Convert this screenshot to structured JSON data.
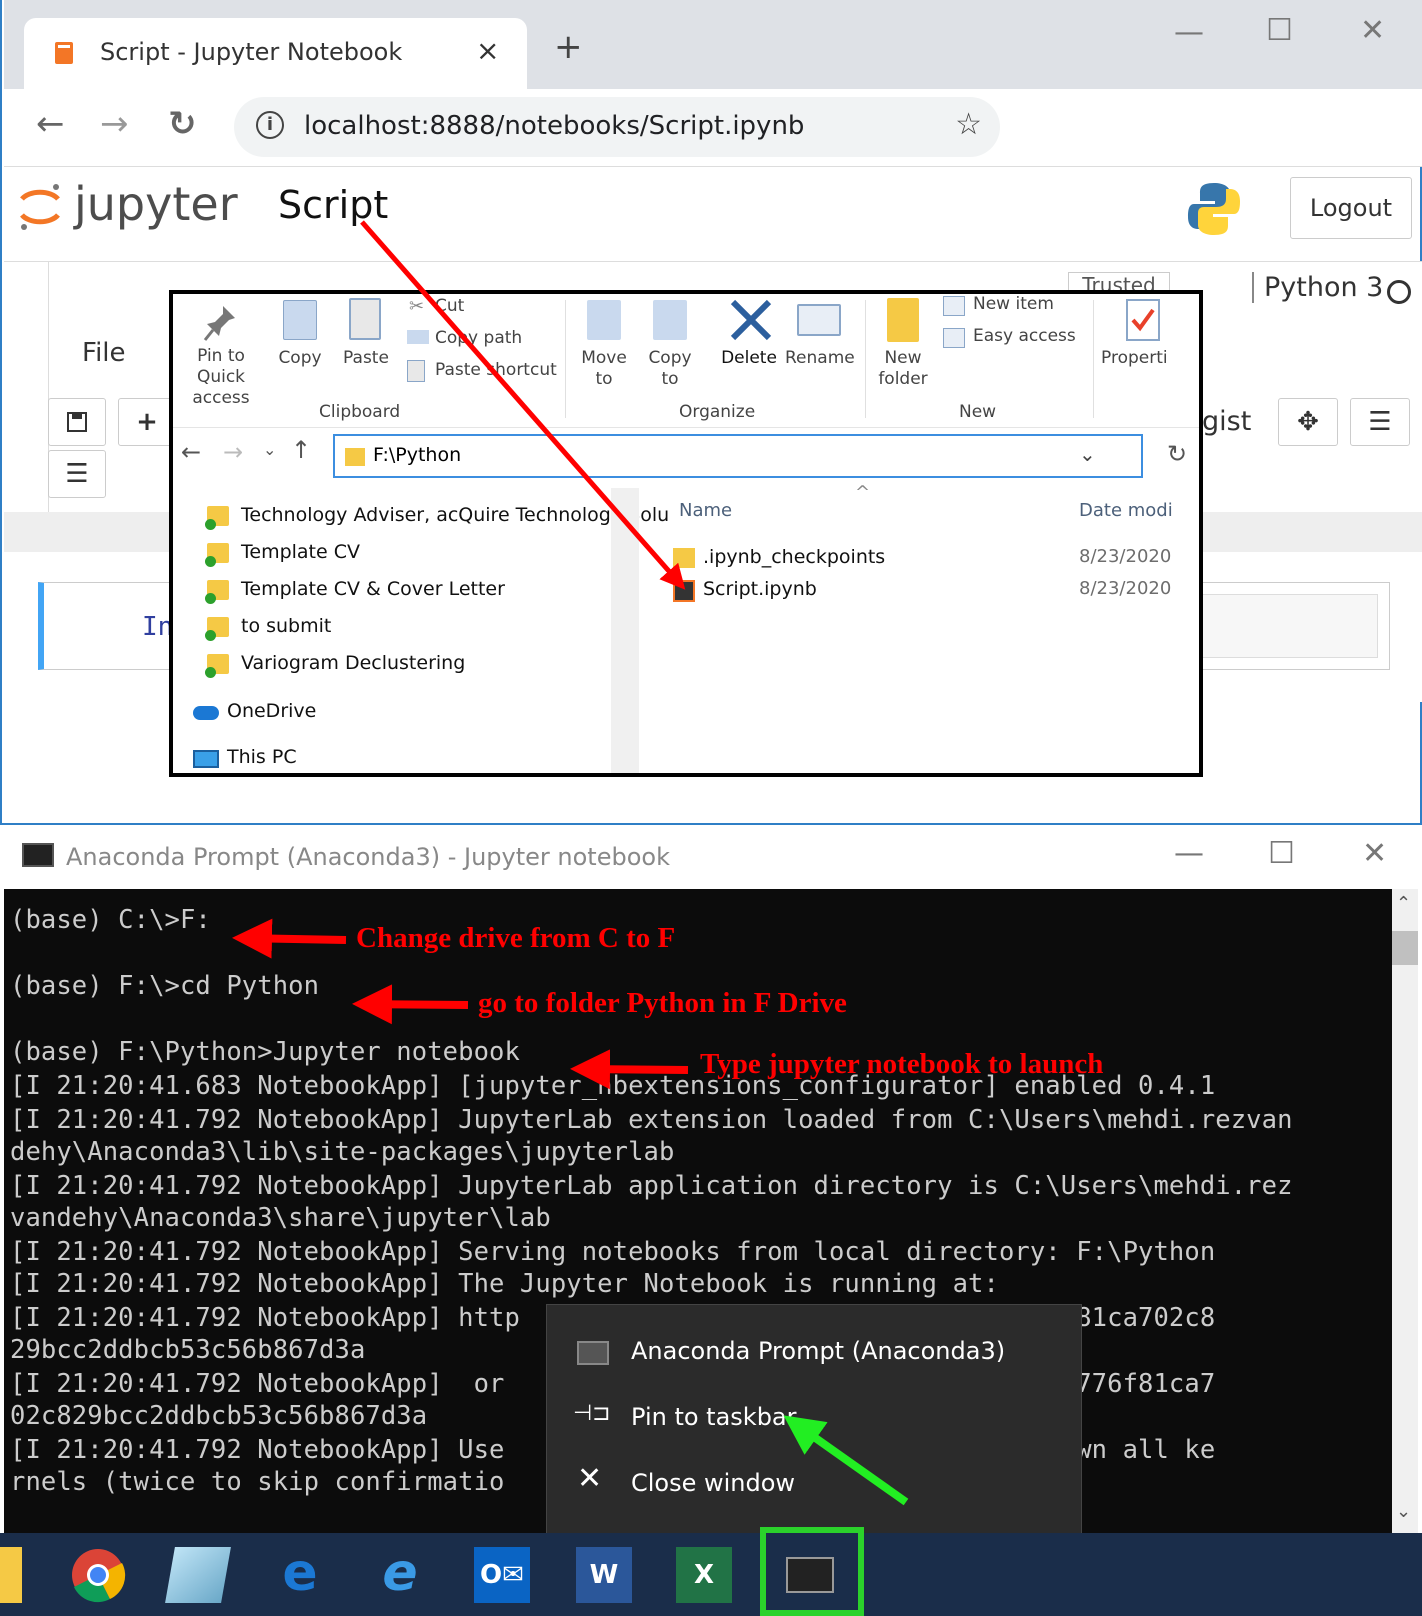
{
  "browser": {
    "tab_title": "Script - Jupyter Notebook",
    "close_tab": "×",
    "new_tab": "+",
    "minimize": "—",
    "maximize": "☐",
    "close": "✕",
    "back": "←",
    "forward": "→",
    "reload": "↻",
    "url": "localhost:8888/notebooks/Script.ipynb",
    "star": "☆",
    "info": "i"
  },
  "jupyter": {
    "logo_text": "jupyter",
    "notebook_name": "Script",
    "logout": "Logout",
    "file_menu": "File",
    "trusted": "Trusted",
    "kernel": "Python 3",
    "gist": "gist",
    "cell_prompt": "In"
  },
  "explorer": {
    "ribbon": {
      "pin": "Pin to Quick access",
      "copy": "Copy",
      "paste": "Paste",
      "cut": "Cut",
      "copy_path": "Copy path",
      "paste_shortcut": "Paste shortcut",
      "clipboard": "Clipboard",
      "move_to": "Move to",
      "copy_to": "Copy to",
      "delete": "Delete",
      "rename": "Rename",
      "organize": "Organize",
      "new_folder": "New folder",
      "new_item": "New item",
      "easy_access": "Easy access",
      "new_group": "New",
      "properties": "Properti"
    },
    "path": "F:\\Python",
    "nav": [
      "Technology Adviser, acQuire Technology Solu",
      "Template CV",
      "Template CV & Cover Letter",
      "to submit",
      "Variogram Declustering"
    ],
    "onedrive": "OneDrive",
    "thispc": "This PC",
    "col_name": "Name",
    "col_date": "Date modi",
    "files": [
      {
        "name": ".ipynb_checkpoints",
        "date": "8/23/2020"
      },
      {
        "name": "Script.ipynb",
        "date": "8/23/2020"
      }
    ]
  },
  "anaconda": {
    "title": "Anaconda Prompt (Anaconda3) - Jupyter  notebook",
    "lines": [
      "(base) C:\\>F:",
      "",
      "(base) F:\\>cd Python",
      "",
      "(base) F:\\Python>Jupyter notebook",
      "[I 21:20:41.683 NotebookApp] [jupyter_nbextensions_configurator] enabled 0.4.1",
      "[I 21:20:41.792 NotebookApp] JupyterLab extension loaded from C:\\Users\\mehdi.rezvan",
      "dehy\\Anaconda3\\lib\\site-packages\\jupyterlab",
      "[I 21:20:41.792 NotebookApp] JupyterLab application directory is C:\\Users\\mehdi.rez",
      "vandehy\\Anaconda3\\share\\jupyter\\lab",
      "[I 21:20:41.792 NotebookApp] Serving notebooks from local directory: F:\\Python",
      "[I 21:20:41.792 NotebookApp] The Jupyter Notebook is running at:",
      "[I 21:20:41.792 NotebookApp] http                          34ad5b776f81ca702c8",
      "29bcc2ddbcb53c56b867d3a",
      "[I 21:20:41.792 NotebookApp]  or                           dfde84ad5b776f81ca7",
      "02c829bcc2ddbcb53c56b867d3a",
      "[I 21:20:41.792 NotebookApp] Use                           nd shut down all ke",
      "rnels (twice to skip confirmatio"
    ]
  },
  "annotations": {
    "a1": "Change drive from C to F",
    "a2": "go to folder Python in F Drive",
    "a3": "Type jupyter notebook to launch"
  },
  "context_menu": {
    "item1": "Anaconda Prompt (Anaconda3)",
    "item2": "Pin to taskbar",
    "item3": "Close window"
  },
  "colors": {
    "arrow_red": "#ff0000",
    "arrow_green": "#22ee22",
    "highlight_green": "#2bd12b"
  }
}
